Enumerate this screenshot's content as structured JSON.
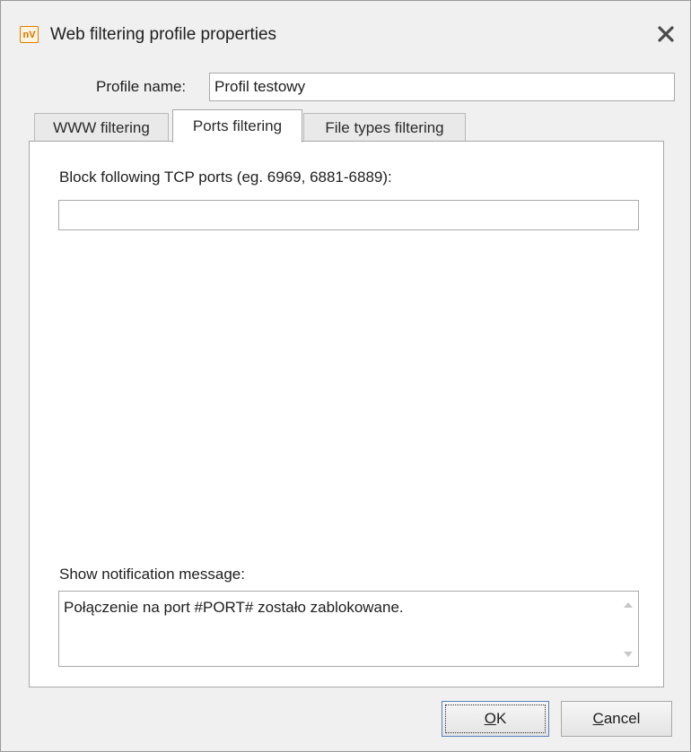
{
  "window": {
    "title": "Web filtering profile properties",
    "icon_text": "nV",
    "icon": "app-logo-icon",
    "close_icon": "close-icon"
  },
  "profile": {
    "label": "Profile name:",
    "value": "Profil testowy"
  },
  "tabs": [
    {
      "label": "WWW filtering",
      "active": false
    },
    {
      "label": "Ports filtering",
      "active": true
    },
    {
      "label": "File types filtering",
      "active": false
    }
  ],
  "ports": {
    "label": "Block following TCP ports (eg. 6969, 6881-6889):",
    "value": "",
    "placeholder": ""
  },
  "notification": {
    "label": "Show notification message:",
    "value": "Połączenie na port #PORT# zostało zablokowane."
  },
  "buttons": {
    "ok": "OK",
    "cancel": "Cancel"
  },
  "colors": {
    "window_bg": "#f0f0f0",
    "panel_bg": "#ffffff",
    "icon_accent": "#e07b00",
    "default_button_border": "#5a7fbf"
  }
}
